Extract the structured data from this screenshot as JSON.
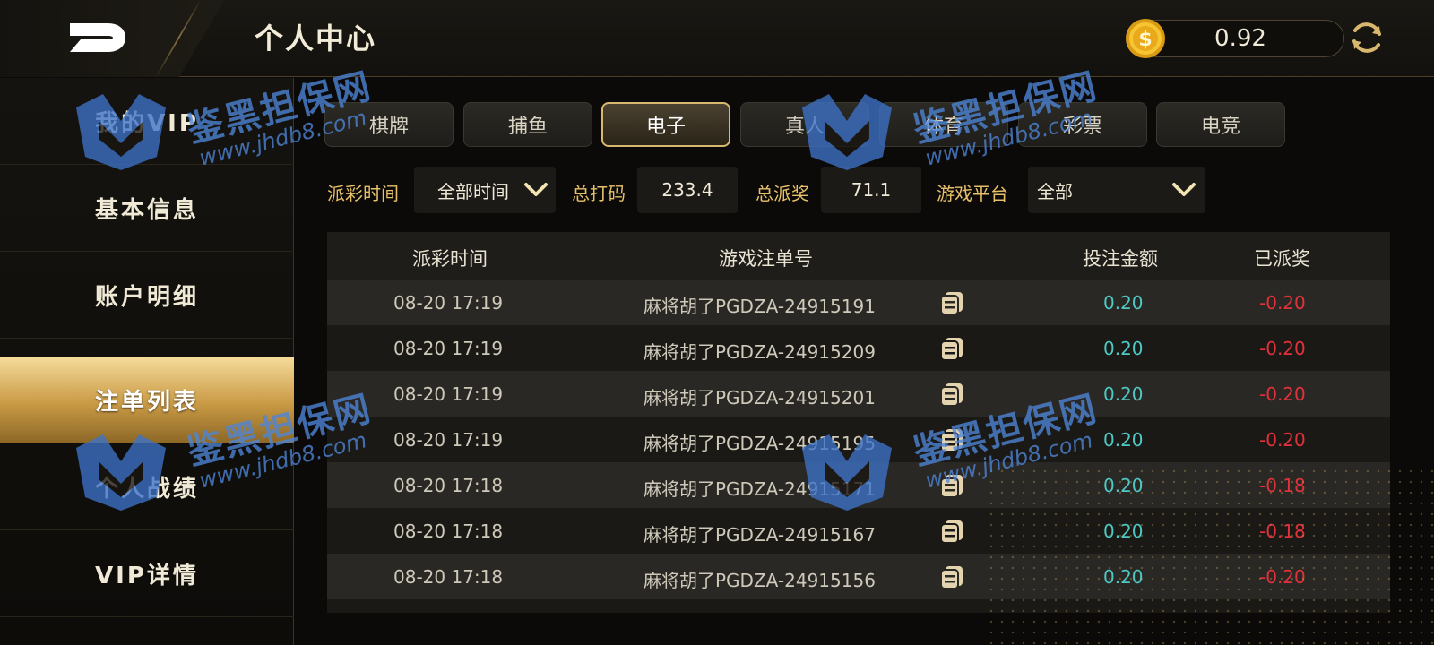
{
  "header": {
    "title": "个人中心",
    "balance": "0.92"
  },
  "sidebar": {
    "items": [
      {
        "label": "我的VIP"
      },
      {
        "label": "基本信息"
      },
      {
        "label": "账户明细"
      },
      {
        "label": "注单列表",
        "active": true
      },
      {
        "label": "个人战绩"
      },
      {
        "label": "VIP详情"
      }
    ]
  },
  "tabs": [
    {
      "label": "棋牌"
    },
    {
      "label": "捕鱼"
    },
    {
      "label": "电子",
      "active": true
    },
    {
      "label": "真人"
    },
    {
      "label": "体育"
    },
    {
      "label": "彩票"
    },
    {
      "label": "电竞"
    }
  ],
  "filters": {
    "payout_time_label": "派彩时间",
    "payout_time_value": "全部时间",
    "total_bet_label": "总打码",
    "total_bet_value": "233.4",
    "total_payout_label": "总派奖",
    "total_payout_value": "71.1",
    "platform_label": "游戏平台",
    "platform_value": "全部"
  },
  "table": {
    "headers": [
      "派彩时间",
      "游戏注单号",
      "投注金额",
      "已派奖"
    ],
    "rows": [
      {
        "time": "08-20 17:19",
        "order": "麻将胡了PGDZA-24915191",
        "bet": "0.20",
        "paid": "-0.20"
      },
      {
        "time": "08-20 17:19",
        "order": "麻将胡了PGDZA-24915209",
        "bet": "0.20",
        "paid": "-0.20"
      },
      {
        "time": "08-20 17:19",
        "order": "麻将胡了PGDZA-24915201",
        "bet": "0.20",
        "paid": "-0.20"
      },
      {
        "time": "08-20 17:19",
        "order": "麻将胡了PGDZA-24915195",
        "bet": "0.20",
        "paid": "-0.20"
      },
      {
        "time": "08-20 17:18",
        "order": "麻将胡了PGDZA-24915171",
        "bet": "0.20",
        "paid": "-0.18"
      },
      {
        "time": "08-20 17:18",
        "order": "麻将胡了PGDZA-24915167",
        "bet": "0.20",
        "paid": "-0.18"
      },
      {
        "time": "08-20 17:18",
        "order": "麻将胡了PGDZA-24915156",
        "bet": "0.20",
        "paid": "-0.20"
      }
    ]
  },
  "watermark": {
    "text": "鉴黑担保网",
    "url": "www.jhdb8.com"
  },
  "colors": {
    "accent_gold": "#e7c06a",
    "bet_cyan": "#4ec8c3",
    "paid_red": "#e0323a",
    "watermark_blue": "#4e86d9"
  },
  "icons": {
    "back": "back-arrow-icon",
    "coin": "coin-icon",
    "refresh": "refresh-icon",
    "dropdown": "chevron-down-icon",
    "copy": "copy-icon"
  }
}
